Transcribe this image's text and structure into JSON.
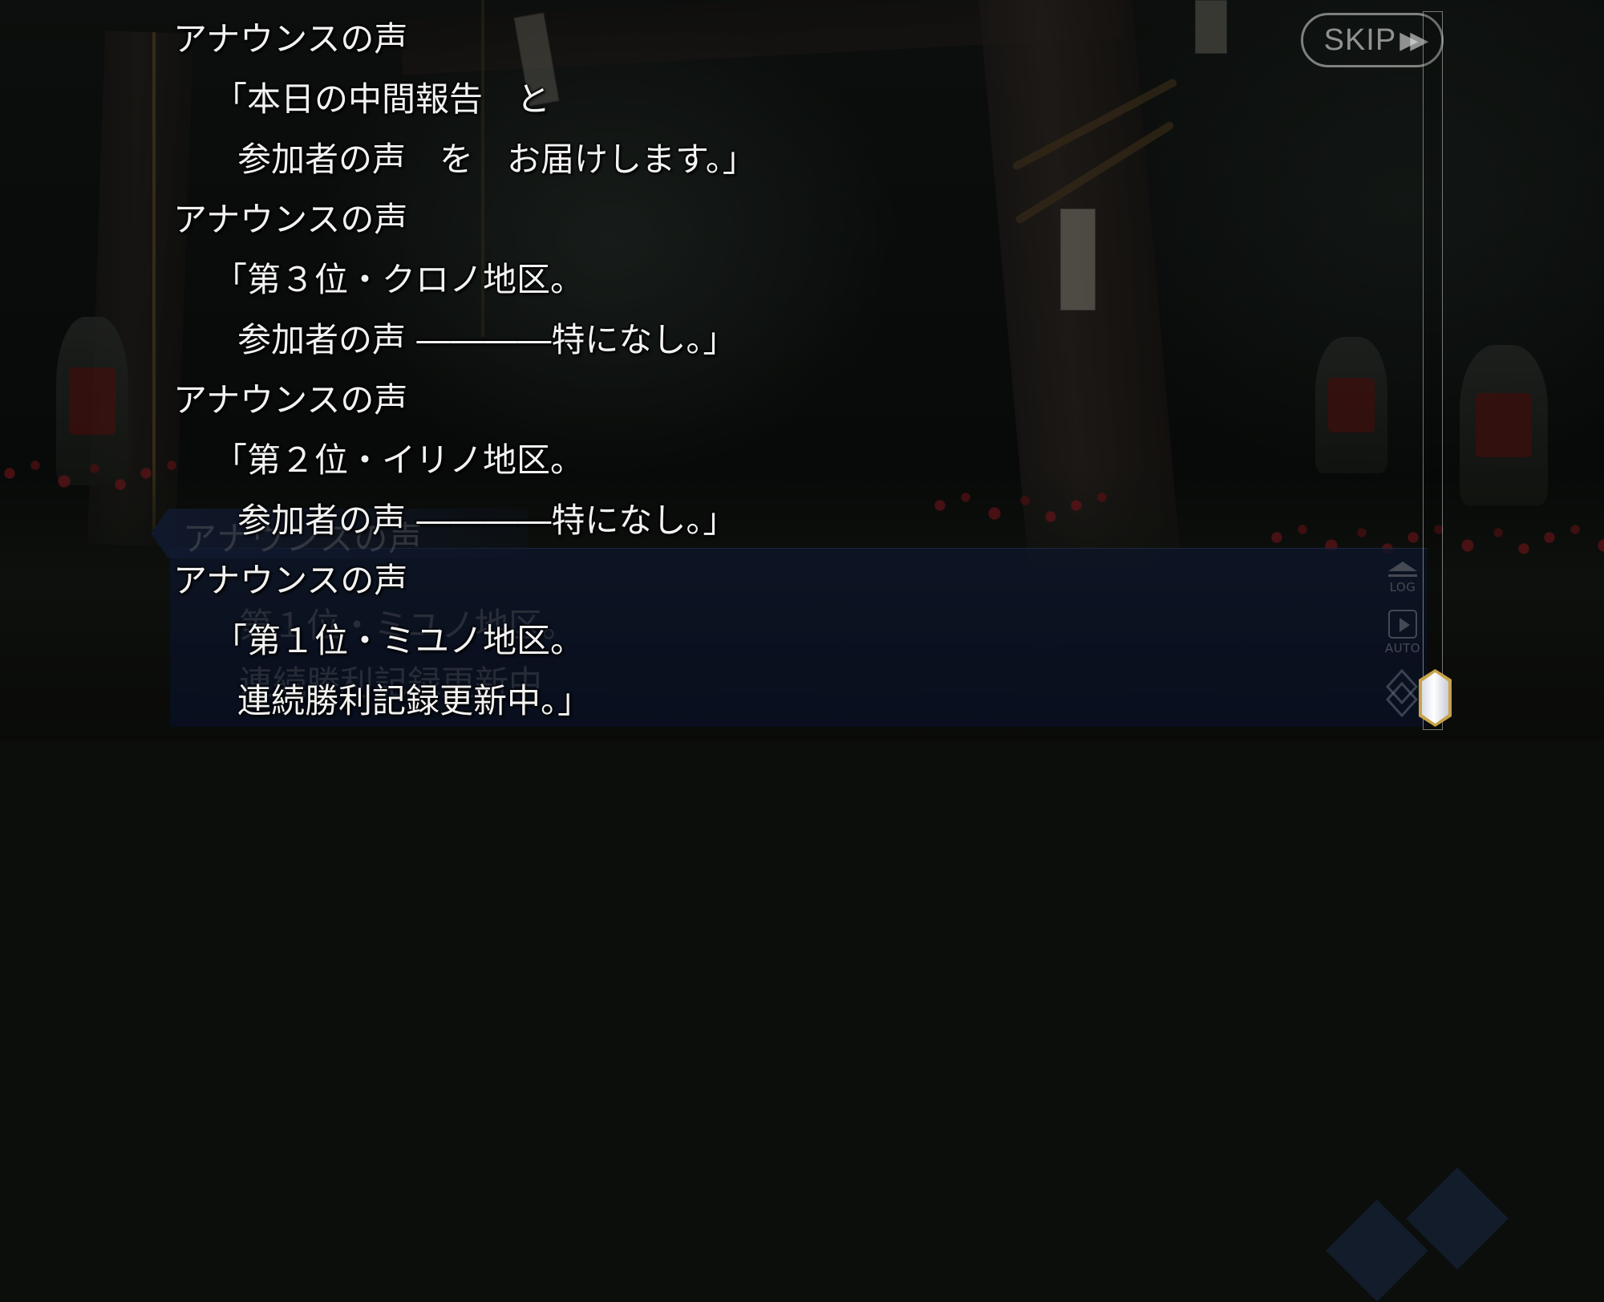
{
  "skip_button": {
    "label": "SKIP",
    "arrows": "▶▶"
  },
  "backlog": [
    {
      "speaker": "アナウンスの声",
      "lines": [
        "「本日の中間報告　と",
        "参加者の声　を　お届けします。」"
      ]
    },
    {
      "speaker": "アナウンスの声",
      "lines": [
        "「第３位・クロノ地区。",
        "参加者の声 ――――特になし。」"
      ]
    },
    {
      "speaker": "アナウンスの声",
      "lines": [
        "「第２位・イリノ地区。",
        "参加者の声 ――――特になし。」"
      ]
    },
    {
      "speaker": "アナウンスの声",
      "lines": [
        "「第１位・ミユノ地区。",
        "連続勝利記録更新中。」"
      ]
    }
  ],
  "message_window": {
    "speaker": "アナウンスの声",
    "lines": [
      "第１位・ミユノ地区。",
      "連続勝利記録更新中"
    ]
  },
  "side_controls": {
    "log_label": "LOG",
    "auto_label": "AUTO"
  },
  "scroll": {
    "position_fraction": 1.0
  },
  "colors": {
    "window_blue": "#16244a",
    "thumb_gold": "#c8a24a",
    "text": "#f2f2f2"
  }
}
